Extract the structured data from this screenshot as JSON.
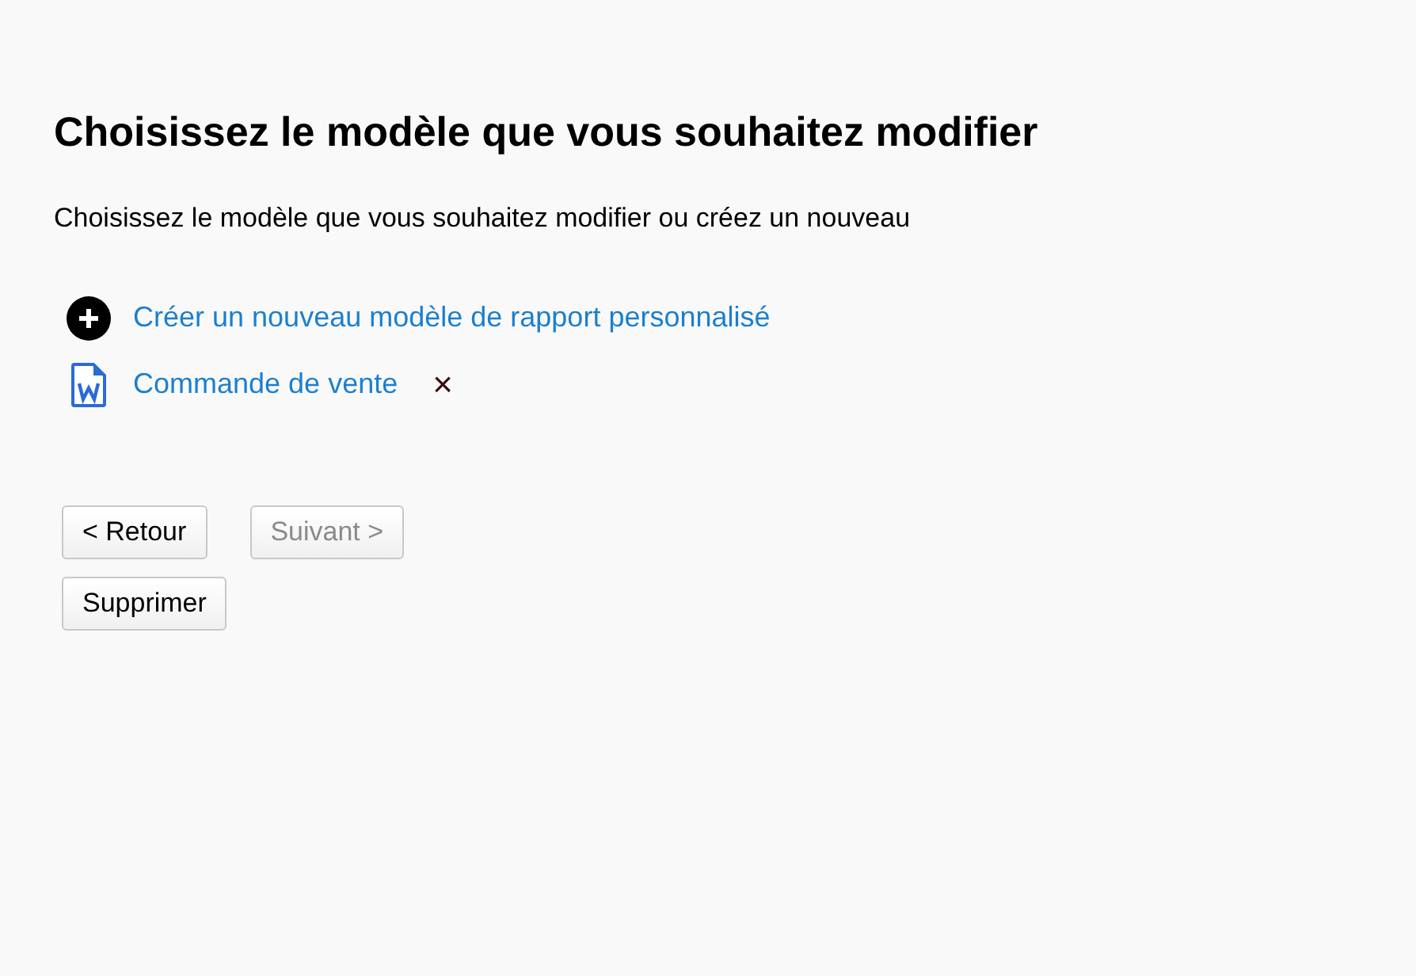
{
  "title": "Choisissez le modèle que vous souhaitez modifier",
  "subtitle": "Choisissez le modèle que vous souhaitez modifier ou créez un nouveau",
  "items": [
    {
      "kind": "create",
      "label": "Créer un nouveau modèle de rapport personnalisé"
    },
    {
      "kind": "template",
      "label": "Commande de vente",
      "remove": "×"
    }
  ],
  "nav_buttons": [
    {
      "label": "< Retour",
      "disabled": false
    },
    {
      "label": "Suivant >",
      "disabled": true
    }
  ],
  "delete_button": {
    "label": "Supprimer",
    "disabled": false
  }
}
